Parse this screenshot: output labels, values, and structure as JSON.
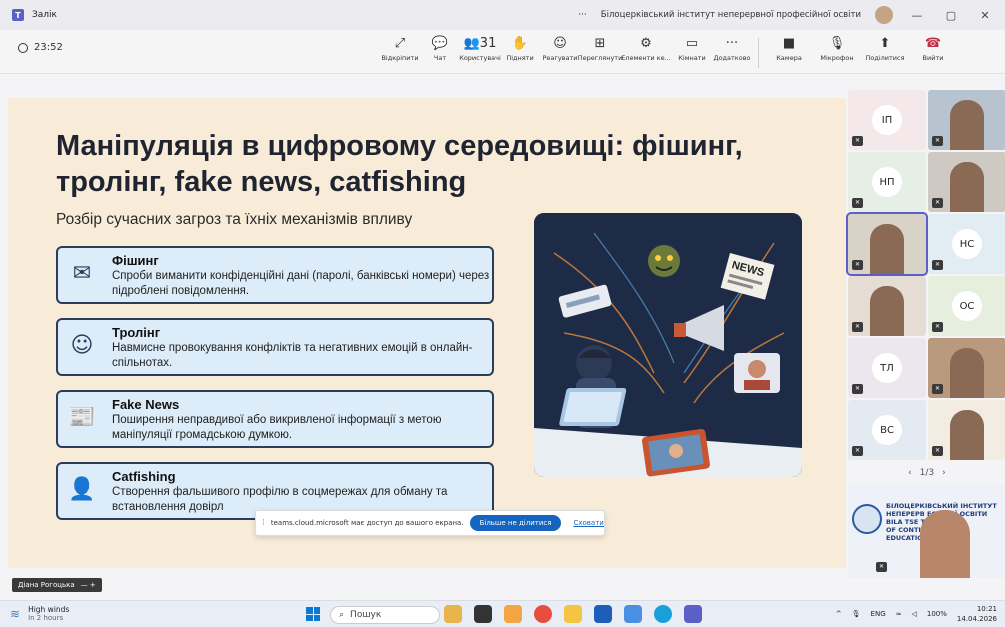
{
  "titlebar": {
    "app_name": "Залік",
    "more": "···",
    "org_name": "Білоцерківський інститут неперервної професійної освіти",
    "minimize": "—",
    "restore": "▢",
    "close": "✕"
  },
  "toolbar": {
    "timer": "23:52",
    "items": [
      {
        "label": "Відкріпити",
        "icon": "unpin-icon",
        "glyph": "⤢"
      },
      {
        "label": "Чат",
        "icon": "chat-icon",
        "glyph": "💬"
      },
      {
        "label": "Користувачі",
        "icon": "people-icon",
        "glyph": "👥31"
      },
      {
        "label": "Підняти",
        "icon": "raise-hand-icon",
        "glyph": "✋"
      },
      {
        "label": "Реагувати",
        "icon": "react-icon",
        "glyph": "☺"
      },
      {
        "label": "Переглянути",
        "icon": "view-icon",
        "glyph": "⊞"
      },
      {
        "label": "Елементи ке...",
        "icon": "apps-icon",
        "glyph": "⚙"
      },
      {
        "label": "Кімнати",
        "icon": "rooms-icon",
        "glyph": "▭"
      },
      {
        "label": "Додатково",
        "icon": "more-icon",
        "glyph": "···"
      },
      {
        "label": "Камера",
        "icon": "camera-icon",
        "glyph": "■"
      },
      {
        "label": "Мікрофон",
        "icon": "mic-off-icon",
        "glyph": "🎙"
      },
      {
        "label": "Поділитися",
        "icon": "share-icon",
        "glyph": "⬆"
      },
      {
        "label": "Вийти",
        "icon": "leave-icon",
        "glyph": "☎"
      }
    ]
  },
  "slide": {
    "title": "Маніпуляція в цифровому середовищі: фішинг, тролінг, fake news, catfishing",
    "subtitle": "Розбір сучасних загроз та їхніх механізмів впливу",
    "cards": [
      {
        "title": "Фішинг",
        "desc": "Спроби виманити конфіденційні дані (паролі, банківські номери) через підроблені повідомлення.",
        "icon": "envelope-hook-icon",
        "glyph": "✉"
      },
      {
        "title": "Тролінг",
        "desc": "Навмисне провокування конфліктів та негативних емоцій в онлайн-спільнотах.",
        "icon": "troll-face-icon",
        "glyph": "☺"
      },
      {
        "title": "Fake News",
        "desc": "Поширення неправдивої або викривленої інформації з метою маніпуляції громадською думкою.",
        "icon": "newspaper-icon",
        "glyph": "📰"
      },
      {
        "title": "Catfishing",
        "desc": "Створення фальшивого профілю в соцмережах для обману та встановлення довірл",
        "icon": "fake-profile-icon",
        "glyph": "👤"
      }
    ],
    "illus_news_label": "NEWS"
  },
  "share_notice": {
    "text": "teams.cloud.microsoft має доступ до вашого екрана.",
    "stop": "Більше не ділитися",
    "hide": "Сховати"
  },
  "presenter": {
    "name": "Діана Рогоцька",
    "extra": "— +"
  },
  "gallery": {
    "tiles": [
      {
        "initials": "ІП",
        "bg": "#f4e8ea"
      },
      {
        "initials": "",
        "bg": "#b7c3cf"
      },
      {
        "initials": "НП",
        "bg": "#e6efe6"
      },
      {
        "initials": "",
        "bg": "#cfc9c3"
      },
      {
        "initials": "",
        "bg": "#d9d2c6"
      },
      {
        "initials": "НС",
        "bg": "#e1edf3"
      },
      {
        "initials": "",
        "bg": "#e5dcd3"
      },
      {
        "initials": "ОС",
        "bg": "#e6efde"
      },
      {
        "initials": "ТЛ",
        "bg": "#ece7ee"
      },
      {
        "initials": "",
        "bg": "#b99a7f"
      },
      {
        "initials": "ВС",
        "bg": "#e4eaf2"
      },
      {
        "initials": "",
        "bg": "#f3ece3"
      }
    ],
    "pager": "1/3",
    "banner_lines": [
      "БІЛОЦЕРКІВСЬКИЙ ІНСТИТУТ",
      "НЕПЕРЕРВ    ЕСІЙНОЇ ОСВІТИ",
      "BILA TSE    TITUTE",
      "OF CONTI    ESSIONAL",
      "EDUCATIO"
    ]
  },
  "taskbar": {
    "weather_title": "High winds",
    "weather_sub": "In 2 hours",
    "search": "Пошук",
    "lang": "ENG",
    "battery": "100%",
    "time": "10:21",
    "date": "14.04.2026"
  }
}
